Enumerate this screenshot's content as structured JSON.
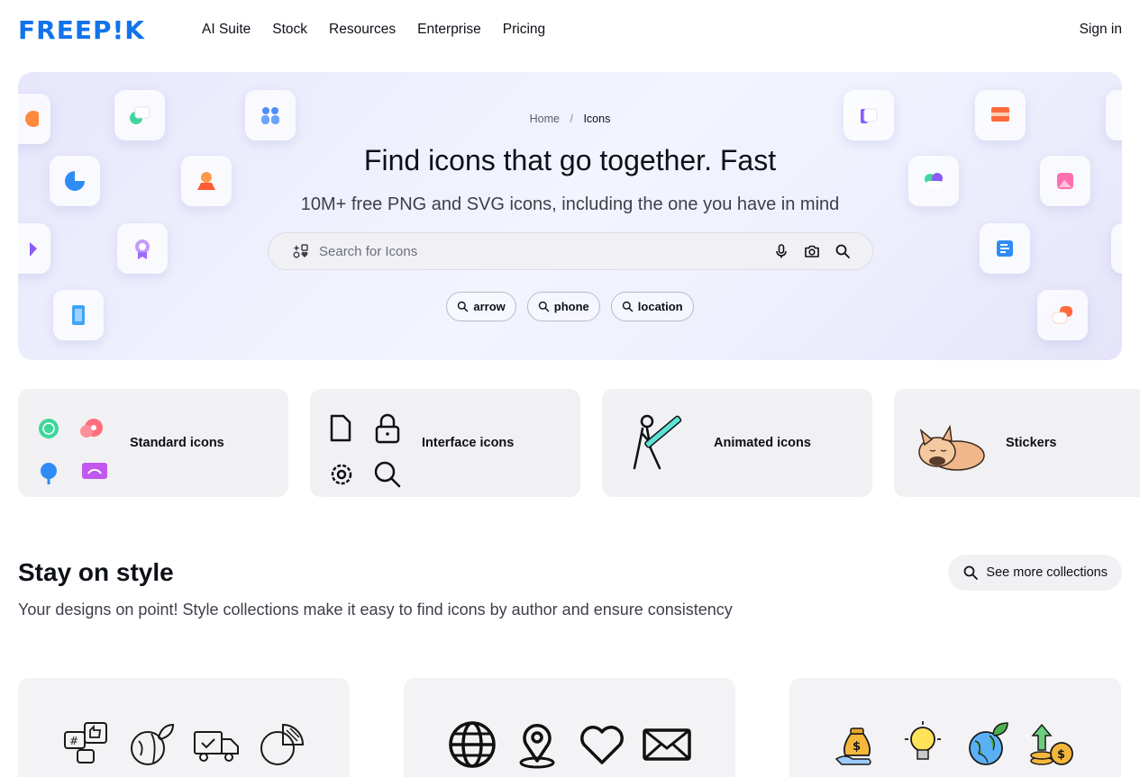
{
  "header": {
    "logo_text": "FREEP!K",
    "nav": [
      {
        "label": "AI Suite"
      },
      {
        "label": "Stock"
      },
      {
        "label": "Resources"
      },
      {
        "label": "Enterprise"
      },
      {
        "label": "Pricing"
      }
    ],
    "sign_in": "Sign in"
  },
  "hero": {
    "breadcrumb": {
      "home": "Home",
      "separator": "/",
      "current": "Icons"
    },
    "title": "Find icons that go together. Fast",
    "subtitle": "10M+ free PNG and SVG icons, including the one you have in mind",
    "search": {
      "placeholder": "Search for Icons"
    },
    "chips": [
      {
        "label": "arrow"
      },
      {
        "label": "phone"
      },
      {
        "label": "location"
      }
    ]
  },
  "categories": [
    {
      "label": "Standard icons"
    },
    {
      "label": "Interface icons"
    },
    {
      "label": "Animated icons"
    },
    {
      "label": "Stickers"
    }
  ],
  "styles_section": {
    "title": "Stay on style",
    "subtitle": "Your designs on point! Style collections make it easy to find icons by author and ensure consistency",
    "more_button": "See more collections"
  },
  "colors": {
    "brand": "#1273eb",
    "text": "#0e1017",
    "card_bg": "#f1f1f3"
  }
}
